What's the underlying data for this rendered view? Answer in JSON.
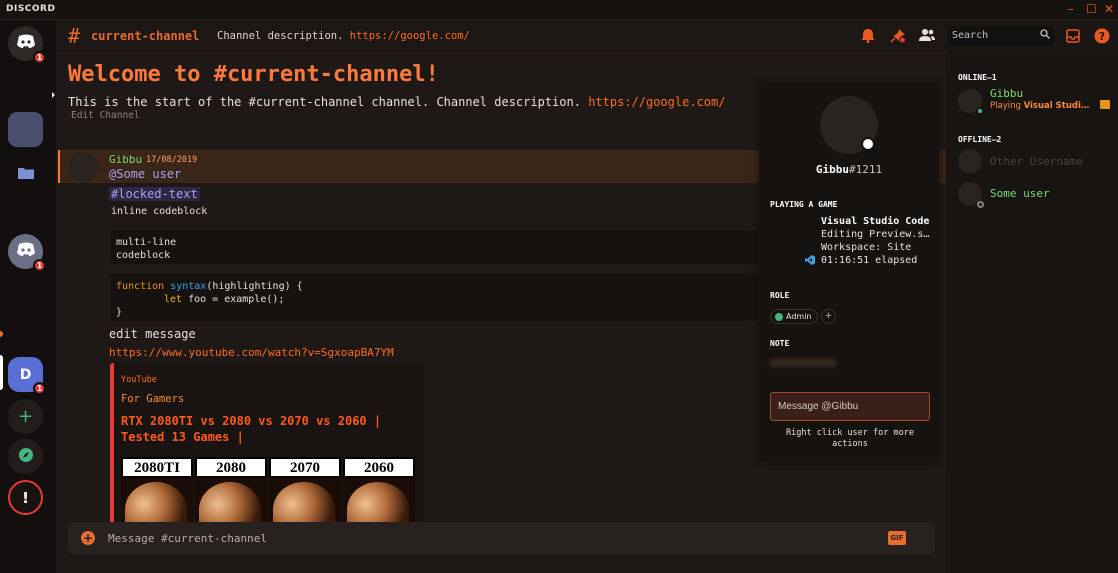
{
  "app": {
    "wordmark": "DISCORD"
  },
  "window_controls": {
    "minimize": "–",
    "maximize": "☐",
    "close": "✕"
  },
  "guilds": {
    "home_badge": "1",
    "server2_badge": "1",
    "server_d_letter": "D",
    "server_d_badge": "1",
    "add_symbol": "+",
    "alert_symbol": "!"
  },
  "channel_header": {
    "hash": "#",
    "name": "current-channel",
    "description": "Channel description.",
    "description_link": "https://google.com/",
    "search_placeholder": "Search"
  },
  "welcome": {
    "title": "Welcome to #current-channel!",
    "start_text": "This is the start of the #current-channel channel. Channel description.",
    "start_link": "https://google.com/",
    "edit_channel": "Edit Channel"
  },
  "message": {
    "author": "Gibbu",
    "date": "17/08/2019",
    "mention": "@Some user",
    "locked_text": "#locked-text",
    "inline_code": "inline codeblock",
    "codeblock_lines": [
      "multi-line",
      "codeblock"
    ],
    "syntax": {
      "kw1": "function",
      "fname": "syntax",
      "params": "(highlighting) {",
      "kw2": "let",
      "body": " foo = example();",
      "close": "}"
    },
    "edit_text": "edit message",
    "youtube_link": "https://www.youtube.com/watch?v=SgxoapBA7YM"
  },
  "embed": {
    "provider": "YouTube",
    "author": "For Gamers",
    "title": "RTX 2080TI vs 2080 vs 2070 vs 2060 | Tested 13 Games |",
    "thumbnail_labels": [
      "2080TI",
      "2080",
      "2070",
      "2060"
    ]
  },
  "composer": {
    "placeholder": "Message #current-channel",
    "gif_label": "GIF"
  },
  "popout": {
    "username": "Gibbu",
    "discriminator": "#1211",
    "activity_header": "PLAYING A GAME",
    "game_name": "Visual Studio Code",
    "game_details": "Editing Preview.s…",
    "game_state": "Workspace: Site",
    "game_elapsed": "01:16:51 elapsed",
    "role_header": "ROLE",
    "role_name": "Admin",
    "role_add": "+",
    "note_header": "NOTE",
    "message_placeholder": "Message @Gibbu",
    "hint": "Right click user for more actions"
  },
  "members": {
    "online_header": "ONLINE—1",
    "offline_header": "OFFLINE—2",
    "online": [
      {
        "name": "Gibbu",
        "activity_prefix": "Playing ",
        "activity_game": "Visual Studi…"
      }
    ],
    "offline": [
      {
        "name": "Other Username"
      },
      {
        "name": "Some user"
      }
    ]
  },
  "colors": {
    "accent": "#e86c2c",
    "online": "#43b581",
    "mention_bg": "#2c2842",
    "embed_bar": "#e53935"
  }
}
